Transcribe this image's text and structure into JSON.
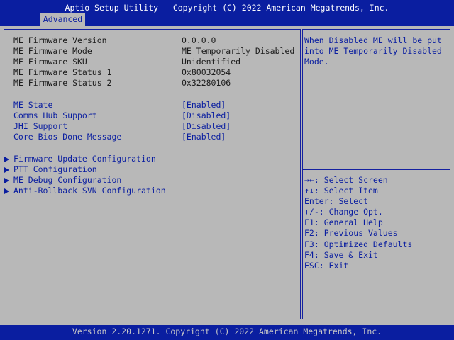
{
  "header": {
    "title": "Aptio Setup Utility – Copyright (C) 2022 American Megatrends, Inc.",
    "tab": "Advanced"
  },
  "info": [
    {
      "label": "ME Firmware Version",
      "value": "0.0.0.0"
    },
    {
      "label": "ME Firmware Mode",
      "value": "ME Temporarily Disabled"
    },
    {
      "label": "ME Firmware SKU",
      "value": "Unidentified"
    },
    {
      "label": "ME Firmware Status 1",
      "value": "0x80032054"
    },
    {
      "label": "ME Firmware Status 2",
      "value": "0x32280106"
    }
  ],
  "options": [
    {
      "label": "ME State",
      "value": "[Enabled]"
    },
    {
      "label": "Comms Hub Support",
      "value": "[Disabled]"
    },
    {
      "label": "JHI Support",
      "value": "[Disabled]"
    },
    {
      "label": "Core Bios Done Message",
      "value": "[Enabled]"
    }
  ],
  "submenus": [
    "Firmware Update Configuration",
    "PTT Configuration",
    "ME Debug Configuration",
    "Anti-Rollback SVN Configuration"
  ],
  "help": [
    "When Disabled ME will be put",
    "into ME Temporarily Disabled",
    "Mode."
  ],
  "keys": [
    "→←: Select Screen",
    "↑↓: Select Item",
    "Enter: Select",
    "+/-: Change Opt.",
    "F1: General Help",
    "F2: Previous Values",
    "F3: Optimized Defaults",
    "F4: Save & Exit",
    "ESC: Exit"
  ],
  "footer": "Version 2.20.1271. Copyright (C) 2022 American Megatrends, Inc.",
  "colors": {
    "background": "#0a1ea0",
    "panel": "#b8b8b8",
    "highlight_text": "#ffffff"
  }
}
